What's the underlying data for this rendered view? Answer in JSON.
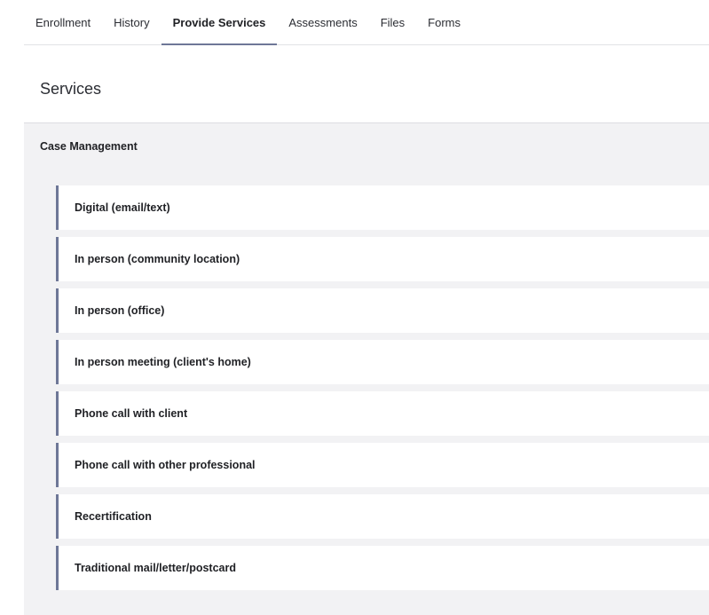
{
  "tabs": [
    {
      "label": "Enrollment",
      "active": false
    },
    {
      "label": "History",
      "active": false
    },
    {
      "label": "Provide Services",
      "active": true
    },
    {
      "label": "Assessments",
      "active": false
    },
    {
      "label": "Files",
      "active": false
    },
    {
      "label": "Forms",
      "active": false
    }
  ],
  "services": {
    "title": "Services",
    "category": {
      "title": "Case Management",
      "items": [
        {
          "label": "Digital (email/text)"
        },
        {
          "label": "In person (community location)"
        },
        {
          "label": "In person (office)"
        },
        {
          "label": "In person meeting (client's home)"
        },
        {
          "label": "Phone call with client"
        },
        {
          "label": "Phone call with other professional"
        },
        {
          "label": "Recertification"
        },
        {
          "label": "Traditional mail/letter/postcard"
        }
      ]
    }
  },
  "colors": {
    "accent": "#6e7797",
    "section_background": "#f2f2f4",
    "card_background": "#ffffff"
  }
}
